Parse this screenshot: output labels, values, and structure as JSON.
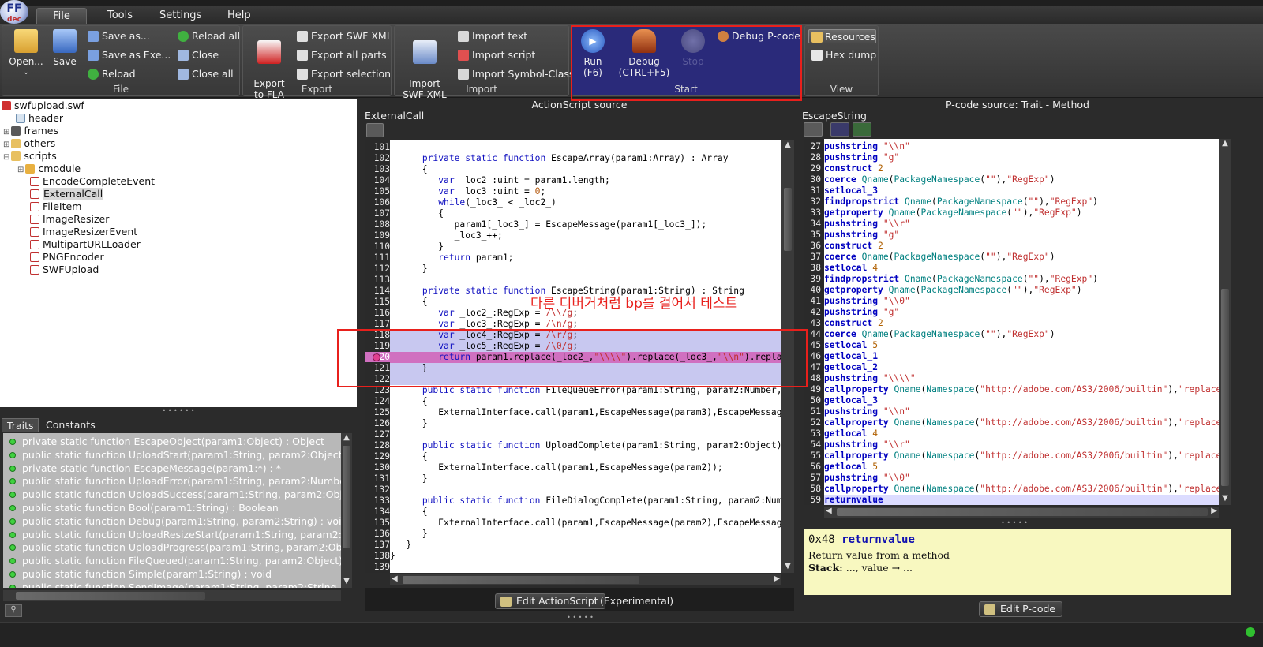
{
  "menu": {
    "file": "File",
    "tools": "Tools",
    "settings": "Settings",
    "help": "Help"
  },
  "ribbon": {
    "file_group": {
      "label": "File",
      "open": "Open...",
      "save": "Save",
      "save_as": "Save as...",
      "save_as_exe": "Save as Exe...",
      "reload": "Reload",
      "reload_all": "Reload all",
      "close": "Close",
      "close_all": "Close all"
    },
    "export_group": {
      "label": "Export",
      "export_to_fla": "Export\nto FLA",
      "export_swf_xml": "Export SWF XML",
      "export_all_parts": "Export all parts",
      "export_selection": "Export selection"
    },
    "import_group": {
      "label": "Import",
      "import_swf_xml": "Import\nSWF XML",
      "import_text": "Import text",
      "import_script": "Import script",
      "import_symbol_class": "Import Symbol-Class"
    },
    "start_group": {
      "label": "Start",
      "run": "Run",
      "run_key": "(F6)",
      "debug": "Debug",
      "debug_key": "(CTRL+F5)",
      "stop": "Stop",
      "debug_pcode": "Debug P-code"
    },
    "view_group": {
      "label": "View",
      "resources": "Resources",
      "hex_dump": "Hex dump"
    }
  },
  "tree": {
    "root": "swfupload.swf",
    "items": [
      "header",
      "frames",
      "others",
      "scripts",
      "cmodule",
      "EncodeCompleteEvent",
      "ExternalCall",
      "FileItem",
      "ImageResizer",
      "ImageResizerEvent",
      "MultipartURLLoader",
      "PNGEncoder",
      "SWFUpload"
    ]
  },
  "traits_tabs": {
    "traits": "Traits",
    "constants": "Constants"
  },
  "traits": [
    "private static function EscapeObject(param1:Object) : Object",
    "public static function UploadStart(param1:String, param2:Object) : vo",
    "private static function EscapeMessage(param1:*) : *",
    "public static function UploadError(param1:String, param2:Number, pa",
    "public static function UploadSuccess(param1:String, param2:Object, p",
    "public static function Bool(param1:String) : Boolean",
    "public static function Debug(param1:String, param2:String) : void",
    "public static function UploadResizeStart(param1:String, param2:Objec",
    "public static function UploadProgress(param1:String, param2:Object,",
    "public static function FileQueued(param1:String, param2:Object) : voi",
    "public static function Simple(param1:String) : void",
    "public static function SendImage(param1:String, param2:String, para"
  ],
  "as_panel": {
    "title": "ActionScript source",
    "class_name": "ExternalCall",
    "edit_button": "Edit ActionScript",
    "experimental": "(Experimental)"
  },
  "annotation": "다른 디버거처럼 bp를 걸어서 테스트",
  "as_code": [
    {
      "n": "101",
      "t": ""
    },
    {
      "n": "102",
      "t": "      <k>private static function</k> EscapeArray(param1:Array) : Array"
    },
    {
      "n": "103",
      "t": "      {"
    },
    {
      "n": "104",
      "t": "         <k>var</k> _loc2_:uint = param1.length;"
    },
    {
      "n": "105",
      "t": "         <k>var</k> _loc3_:uint = <u>0</u>;"
    },
    {
      "n": "106",
      "t": "         <k>while</k>(_loc3_ < _loc2_)"
    },
    {
      "n": "107",
      "t": "         {"
    },
    {
      "n": "108",
      "t": "            param1[_loc3_] = EscapeMessage(param1[_loc3_]);"
    },
    {
      "n": "109",
      "t": "            _loc3_++;"
    },
    {
      "n": "110",
      "t": "         }"
    },
    {
      "n": "111",
      "t": "         <k>return</k> param1;"
    },
    {
      "n": "112",
      "t": "      }"
    },
    {
      "n": "113",
      "t": ""
    },
    {
      "n": "114",
      "t": "      <k>private static function</k> EscapeString(param1:String) : String"
    },
    {
      "n": "115",
      "t": "      {"
    },
    {
      "n": "116",
      "t": "         <k>var</k> _loc2_:RegExp = <s>/\\\\/g</s>;"
    },
    {
      "n": "117",
      "t": "         <k>var</k> _loc3_:RegExp = <s>/\\n/g</s>;"
    },
    {
      "n": "118",
      "t": "         <k>var</k> _loc4_:RegExp = <s>/\\r/g</s>;"
    },
    {
      "n": "119",
      "t": "         <k>var</k> _loc5_:RegExp = <s>/\\0/g</s>;"
    },
    {
      "n": "120",
      "t": "         <k>return</k> param1.replace(_loc2_,<s>\"\\\\\\\\\"</s>).replace(_loc3_,<s>\"\\\\n\"</s>).replace"
    },
    {
      "n": "121",
      "t": "      }"
    },
    {
      "n": "122",
      "t": ""
    },
    {
      "n": "123",
      "t": "      <k>public static function</k> FileQueueError(param1:String, param2:Number, p"
    },
    {
      "n": "124",
      "t": "      {"
    },
    {
      "n": "125",
      "t": "         ExternalInterface.call(param1,EscapeMessage(param3),EscapeMessage("
    },
    {
      "n": "126",
      "t": "      }"
    },
    {
      "n": "127",
      "t": ""
    },
    {
      "n": "128",
      "t": "      <k>public static function</k> UploadComplete(param1:String, param2:Object) :"
    },
    {
      "n": "129",
      "t": "      {"
    },
    {
      "n": "130",
      "t": "         ExternalInterface.call(param1,EscapeMessage(param2));"
    },
    {
      "n": "131",
      "t": "      }"
    },
    {
      "n": "132",
      "t": ""
    },
    {
      "n": "133",
      "t": "      <k>public static function</k> FileDialogComplete(param1:String, param2:Numbe"
    },
    {
      "n": "134",
      "t": "      {"
    },
    {
      "n": "135",
      "t": "         ExternalInterface.call(param1,EscapeMessage(param2),EscapeMessage("
    },
    {
      "n": "136",
      "t": "      }"
    },
    {
      "n": "137",
      "t": "   }"
    },
    {
      "n": "138",
      "t": "}"
    },
    {
      "n": "139",
      "t": ""
    }
  ],
  "pcode_panel": {
    "title": "P-code source: Trait - Method",
    "method_name": "EscapeString",
    "edit_button": "Edit P-code"
  },
  "pcode": [
    {
      "n": "27",
      "t": "<p>pushstring</p> <s>\"\\\\n\"</s>"
    },
    {
      "n": "28",
      "t": "<p>pushstring</p> <s>\"g\"</s>"
    },
    {
      "n": "29",
      "t": "<p>construct</p> <n>2</n>"
    },
    {
      "n": "30",
      "t": "<p>coerce</p> <q>Qname</q>(<q>PackageNamespace</q>(<s>\"\"</s>),<s>\"RegExp\"</s>)"
    },
    {
      "n": "31",
      "t": "<p>setlocal_3</p>"
    },
    {
      "n": "32",
      "t": "<p>findpropstrict</p> <q>Qname</q>(<q>PackageNamespace</q>(<s>\"\"</s>),<s>\"RegExp\"</s>)"
    },
    {
      "n": "33",
      "t": "<p>getproperty</p> <q>Qname</q>(<q>PackageNamespace</q>(<s>\"\"</s>),<s>\"RegExp\"</s>)"
    },
    {
      "n": "34",
      "t": "<p>pushstring</p> <s>\"\\\\r\"</s>"
    },
    {
      "n": "35",
      "t": "<p>pushstring</p> <s>\"g\"</s>"
    },
    {
      "n": "36",
      "t": "<p>construct</p> <n>2</n>"
    },
    {
      "n": "37",
      "t": "<p>coerce</p> <q>Qname</q>(<q>PackageNamespace</q>(<s>\"\"</s>),<s>\"RegExp\"</s>)"
    },
    {
      "n": "38",
      "t": "<p>setlocal</p> <n>4</n>"
    },
    {
      "n": "39",
      "t": "<p>findpropstrict</p> <q>Qname</q>(<q>PackageNamespace</q>(<s>\"\"</s>),<s>\"RegExp\"</s>)"
    },
    {
      "n": "40",
      "t": "<p>getproperty</p> <q>Qname</q>(<q>PackageNamespace</q>(<s>\"\"</s>),<s>\"RegExp\"</s>)"
    },
    {
      "n": "41",
      "t": "<p>pushstring</p> <s>\"\\\\0\"</s>"
    },
    {
      "n": "42",
      "t": "<p>pushstring</p> <s>\"g\"</s>"
    },
    {
      "n": "43",
      "t": "<p>construct</p> <n>2</n>"
    },
    {
      "n": "44",
      "t": "<p>coerce</p> <q>Qname</q>(<q>PackageNamespace</q>(<s>\"\"</s>),<s>\"RegExp\"</s>)"
    },
    {
      "n": "45",
      "t": "<p>setlocal</p> <n>5</n>"
    },
    {
      "n": "46",
      "t": "<p>getlocal_1</p>"
    },
    {
      "n": "47",
      "t": "<p>getlocal_2</p>"
    },
    {
      "n": "48",
      "t": "<p>pushstring</p> <s>\"\\\\\\\\\"</s>"
    },
    {
      "n": "49",
      "t": "<p>callproperty</p> <q>Qname</q>(<q>Namespace</q>(<s>\"http://adobe.com/AS3/2006/builtin\"</s>),<s>\"replace\"</s>)"
    },
    {
      "n": "50",
      "t": "<p>getlocal_3</p>"
    },
    {
      "n": "51",
      "t": "<p>pushstring</p> <s>\"\\\\n\"</s>"
    },
    {
      "n": "52",
      "t": "<p>callproperty</p> <q>Qname</q>(<q>Namespace</q>(<s>\"http://adobe.com/AS3/2006/builtin\"</s>),<s>\"replace\"</s>)"
    },
    {
      "n": "53",
      "t": "<p>getlocal</p> <n>4</n>"
    },
    {
      "n": "54",
      "t": "<p>pushstring</p> <s>\"\\\\r\"</s>"
    },
    {
      "n": "55",
      "t": "<p>callproperty</p> <q>Qname</q>(<q>Namespace</q>(<s>\"http://adobe.com/AS3/2006/builtin\"</s>),<s>\"replace\"</s>)"
    },
    {
      "n": "56",
      "t": "<p>getlocal</p> <n>5</n>"
    },
    {
      "n": "57",
      "t": "<p>pushstring</p> <s>\"\\\\0\"</s>"
    },
    {
      "n": "58",
      "t": "<p>callproperty</p> <q>Qname</q>(<q>Namespace</q>(<s>\"http://adobe.com/AS3/2006/builtin\"</s>),<s>\"replace\"</s>)"
    },
    {
      "n": "59",
      "t": "<p>returnvalue</p>"
    }
  ],
  "doc": {
    "opcode": "0x48",
    "name": "returnvalue",
    "desc": "Return value from a method",
    "stack_label": "Stack:",
    "stack": "..., value → ..."
  }
}
